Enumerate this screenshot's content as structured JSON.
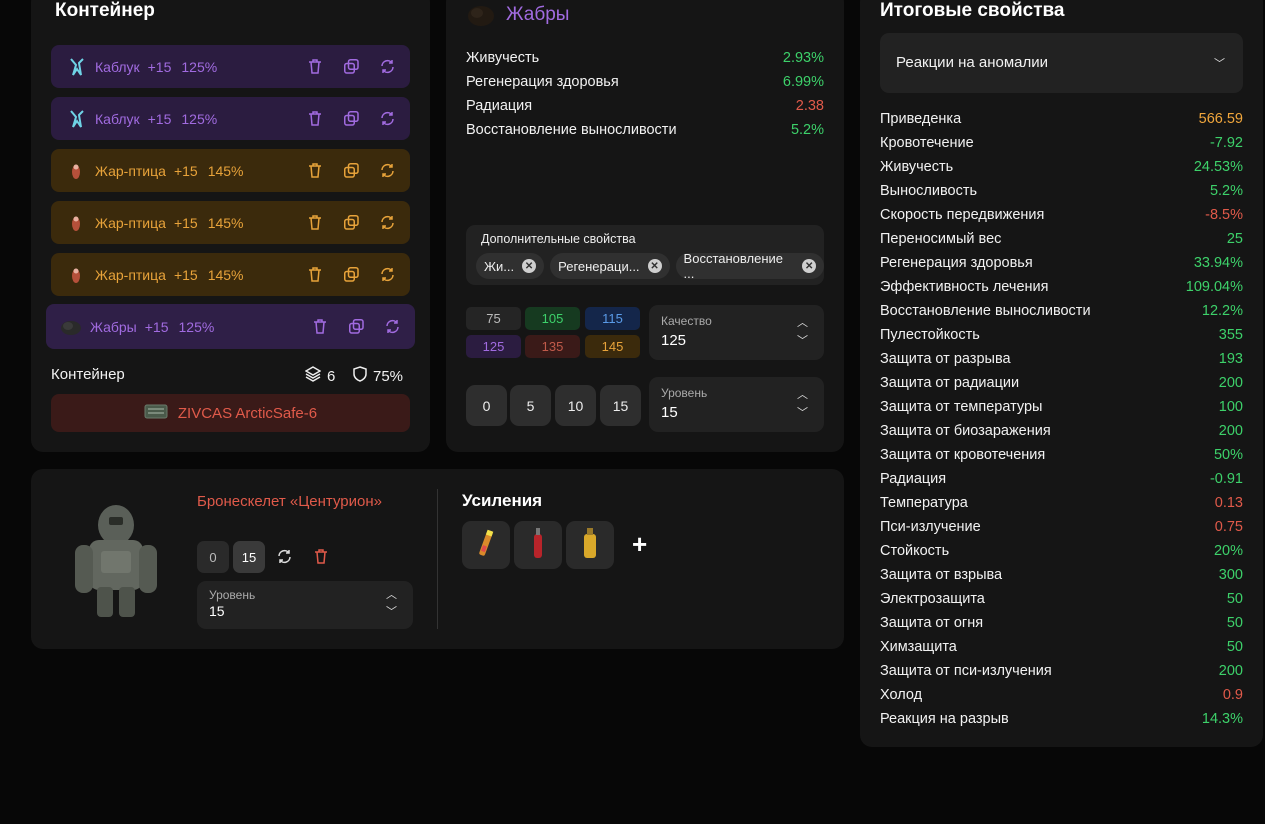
{
  "container_panel": {
    "title": "Контейнер",
    "items": [
      {
        "name": "Каблук",
        "plus": "+15",
        "percent": "125%"
      },
      {
        "name": "Каблук",
        "plus": "+15",
        "percent": "125%"
      },
      {
        "name": "Жар-птица",
        "plus": "+15",
        "percent": "145%"
      },
      {
        "name": "Жар-птица",
        "plus": "+15",
        "percent": "145%"
      },
      {
        "name": "Жар-птица",
        "plus": "+15",
        "percent": "145%"
      },
      {
        "name": "Жабры",
        "plus": "+15",
        "percent": "125%"
      }
    ],
    "footer_label": "Контейнер",
    "slots_count": "6",
    "protection": "75%",
    "container_name": "ZIVCAS ArcticSafe-6"
  },
  "artifact_panel": {
    "title": "Жабры",
    "stats": [
      {
        "name": "Живучесть",
        "value": "2.93%",
        "color": "g"
      },
      {
        "name": "Регенерация здоровья",
        "value": "6.99%",
        "color": "g"
      },
      {
        "name": "Радиация",
        "value": "2.38",
        "color": "r"
      },
      {
        "name": "Восстановление выносливости",
        "value": "5.2%",
        "color": "g"
      }
    ],
    "extra_title": "Дополнительные свойства",
    "extra_chips": [
      "Жи...",
      "Регенераци...",
      "Восстановление ..."
    ],
    "qualities": [
      "75",
      "105",
      "115",
      "125",
      "135",
      "145"
    ],
    "quality_label": "Качество",
    "quality_value": "125",
    "levels": [
      "0",
      "5",
      "10",
      "15"
    ],
    "level_label": "Уровень",
    "level_value": "15"
  },
  "armor_panel": {
    "name": "Бронескелет «Центурион»",
    "level_buttons": [
      "0",
      "15"
    ],
    "level_label": "Уровень",
    "level_value": "15",
    "boosts_title": "Усиления",
    "add_symbol": "+"
  },
  "totals_panel": {
    "title": "Итоговые свойства",
    "dropdown_value": "Реакции на аномалии",
    "stats": [
      {
        "name": "Приведенка",
        "value": "566.59",
        "color": "o"
      },
      {
        "name": "Кровотечение",
        "value": "-7.92",
        "color": "g"
      },
      {
        "name": "Живучесть",
        "value": "24.53%",
        "color": "g"
      },
      {
        "name": "Выносливость",
        "value": "5.2%",
        "color": "g"
      },
      {
        "name": "Скорость передвижения",
        "value": "-8.5%",
        "color": "r"
      },
      {
        "name": "Переносимый вес",
        "value": "25",
        "color": "g"
      },
      {
        "name": "Регенерация здоровья",
        "value": "33.94%",
        "color": "g"
      },
      {
        "name": "Эффективность лечения",
        "value": "109.04%",
        "color": "g"
      },
      {
        "name": "Восстановление выносливости",
        "value": "12.2%",
        "color": "g"
      },
      {
        "name": "Пулестойкость",
        "value": "355",
        "color": "g"
      },
      {
        "name": "Защита от разрыва",
        "value": "193",
        "color": "g"
      },
      {
        "name": "Защита от радиации",
        "value": "200",
        "color": "g"
      },
      {
        "name": "Защита от температуры",
        "value": "100",
        "color": "g"
      },
      {
        "name": "Защита от биозаражения",
        "value": "200",
        "color": "g"
      },
      {
        "name": "Защита от кровотечения",
        "value": "50%",
        "color": "g"
      },
      {
        "name": "Радиация",
        "value": "-0.91",
        "color": "g"
      },
      {
        "name": "Температура",
        "value": "0.13",
        "color": "r"
      },
      {
        "name": "Пси-излучение",
        "value": "0.75",
        "color": "r"
      },
      {
        "name": "Стойкость",
        "value": "20%",
        "color": "g"
      },
      {
        "name": "Защита от взрыва",
        "value": "300",
        "color": "g"
      },
      {
        "name": "Электрозащита",
        "value": "50",
        "color": "g"
      },
      {
        "name": "Защита от огня",
        "value": "50",
        "color": "g"
      },
      {
        "name": "Химзащита",
        "value": "50",
        "color": "g"
      },
      {
        "name": "Защита от пси-излучения",
        "value": "200",
        "color": "g"
      },
      {
        "name": "Холод",
        "value": "0.9",
        "color": "r"
      },
      {
        "name": "Реакция на разрыв",
        "value": "14.3%",
        "color": "g"
      }
    ]
  }
}
